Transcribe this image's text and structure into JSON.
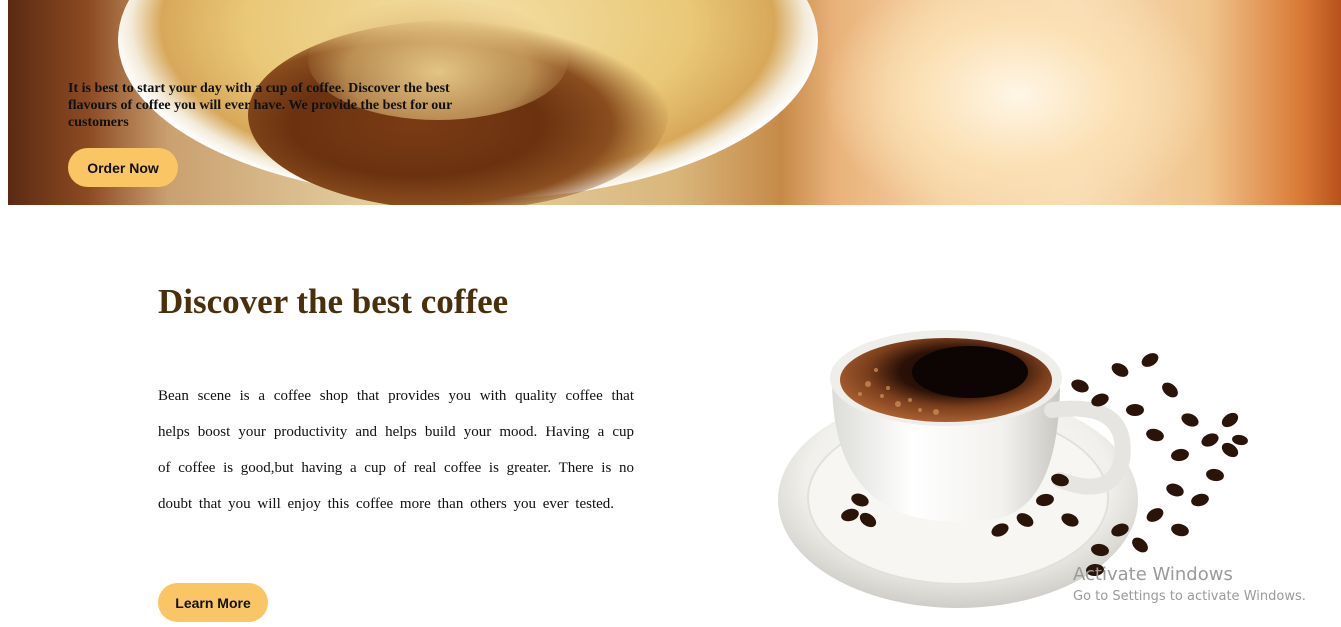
{
  "hero": {
    "tagline": "It is best to start your day with a cup of coffee. Discover the best flavours of coffee you will ever have. We provide the best for our customers",
    "order_button": "Order Now"
  },
  "about": {
    "title": "Discover the best coffee",
    "body": "Bean scene is a coffee shop that provides you with quality coffee that helps boost your productivity and helps build your mood. Having a cup of coffee is good,but having a cup of real coffee is greater. There is no doubt that you will enjoy this coffee more than others you ever tested.",
    "learn_button": "Learn More"
  },
  "watermark": {
    "title": "Activate Windows",
    "subtitle": "Go to Settings to activate Windows."
  },
  "colors": {
    "button": "#f9c565",
    "heading": "#4a2f0c",
    "watermark": "#9a9a9a"
  }
}
